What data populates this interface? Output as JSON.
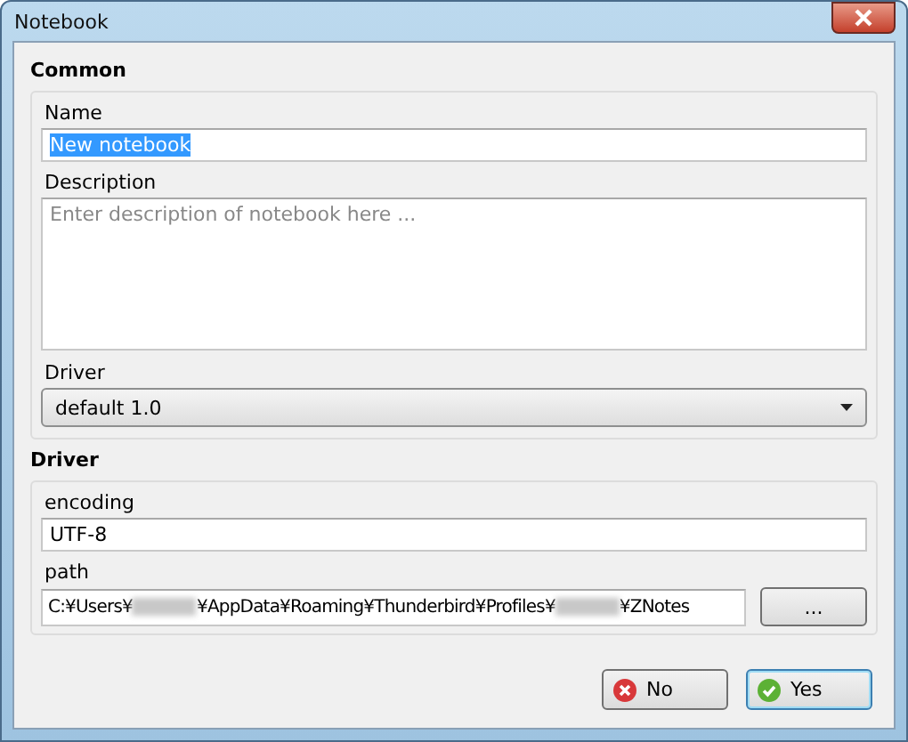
{
  "window": {
    "title": "Notebook"
  },
  "common": {
    "heading": "Common",
    "name_label": "Name",
    "name_value": "New notebook",
    "name_selected": true,
    "description_label": "Description",
    "description_placeholder": "Enter description of notebook here ...",
    "driver_label": "Driver",
    "driver_value": "default 1.0"
  },
  "driver": {
    "heading": "Driver",
    "encoding_label": "encoding",
    "encoding_value": "UTF-8",
    "path_label": "path",
    "path_segments": [
      {
        "kind": "text",
        "text": "C:¥Users¥"
      },
      {
        "kind": "redacted"
      },
      {
        "kind": "text",
        "text": "¥AppData¥Roaming¥Thunderbird¥Profiles¥"
      },
      {
        "kind": "redacted"
      },
      {
        "kind": "text",
        "text": "¥ZNotes"
      }
    ],
    "browse_button": "..."
  },
  "buttons": [
    {
      "kind": "no",
      "label": "No"
    },
    {
      "kind": "yes",
      "label": "Yes"
    }
  ]
}
